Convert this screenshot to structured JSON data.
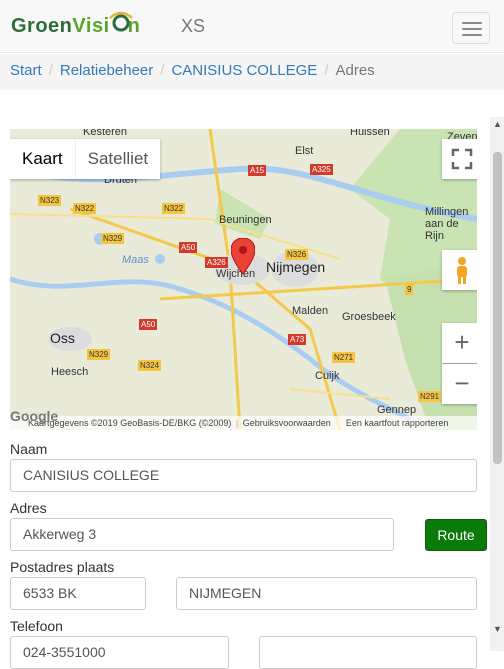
{
  "navbar": {
    "brand_part1": "Groen",
    "brand_part2": "Visi",
    "brand_part3": "n",
    "text": "XS",
    "menu_icon": "hamburger-menu-icon"
  },
  "breadcrumb": {
    "items": [
      "Start",
      "Relatiebeheer",
      "CANISIUS COLLEGE"
    ],
    "active": "Adres"
  },
  "map": {
    "type_buttons": [
      "Kaart",
      "Satelliet"
    ],
    "places": [
      "Kesteren",
      "Huissen",
      "Zevenaar",
      "Elst",
      "Druten",
      "Beuningen",
      "Millingen aan de Rijn",
      "Nijmegen",
      "Wijchen",
      "Maas",
      "Malden",
      "Groesbeek",
      "Oss",
      "Heesch",
      "Cuijk",
      "Gennep"
    ],
    "roads": [
      "A15",
      "A325",
      "N323",
      "N322",
      "N322",
      "N329",
      "A50",
      "A326",
      "N326",
      "A50",
      "A73",
      "N329",
      "N324",
      "N271",
      "N291",
      "9"
    ],
    "attribution": "Kaartgegevens ©2019 GeoBasis-DE/BKG (©2009)",
    "terms": "Gebruiksvoorwaarden",
    "report": "Een kaartfout rapporteren",
    "google": "Google",
    "zoom_in": "+",
    "zoom_out": "−"
  },
  "form": {
    "naam_label": "Naam",
    "naam_value": "CANISIUS COLLEGE",
    "adres_label": "Adres",
    "adres_value": "Akkerweg 3",
    "route_button": "Route",
    "postadres_label": "Postadres plaats",
    "postcode_value": "6533 BK",
    "plaats_value": "NIJMEGEN",
    "telefoon_label": "Telefoon",
    "telefoon_value": "024-3551000",
    "telefoon2_value": ""
  },
  "colors": {
    "accent_green": "#0a7a0a",
    "link_blue": "#337ab7"
  }
}
